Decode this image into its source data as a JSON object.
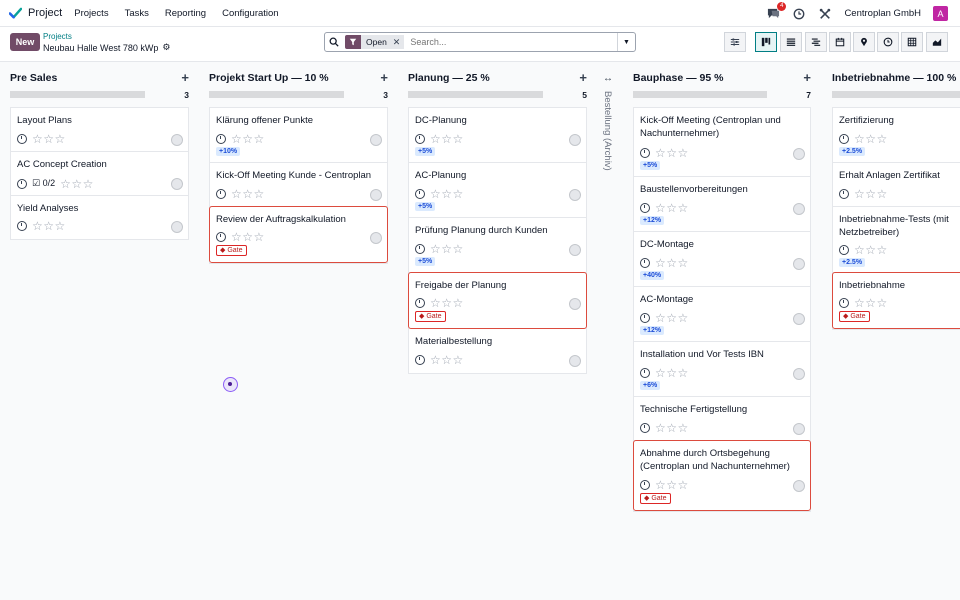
{
  "navbar": {
    "app_name": "Project",
    "menu": [
      "Projects",
      "Tasks",
      "Reporting",
      "Configuration"
    ],
    "chat_badge": "4",
    "company": "Centroplan GmbH",
    "avatar_letter": "A"
  },
  "control": {
    "new_label": "New",
    "breadcrumb_parent": "Projects",
    "breadcrumb_current": "Neubau Halle West 780 kWp",
    "facet_value": "Open",
    "search_placeholder": "Search..."
  },
  "columns": [
    {
      "title": "Pre Sales",
      "count": "3",
      "cards": [
        {
          "title": "Layout Plans"
        },
        {
          "title": "AC Concept Creation",
          "checklist": "0/2"
        },
        {
          "title": "Yield Analyses"
        }
      ]
    },
    {
      "title": "Projekt Start Up — 10 %",
      "count": "3",
      "cards": [
        {
          "title": "Klärung offener Punkte",
          "tag": "+10%"
        },
        {
          "title": "Kick-Off Meeting Kunde - Centroplan"
        },
        {
          "title": "Review der Auftragskalkulation",
          "gate": "Gate"
        }
      ]
    },
    {
      "title": "Planung — 25 %",
      "count": "5",
      "cards": [
        {
          "title": "DC-Planung",
          "tag": "+5%"
        },
        {
          "title": "AC-Planung",
          "tag": "+5%"
        },
        {
          "title": "Prüfung Planung durch Kunden",
          "tag": "+5%"
        },
        {
          "title": "Freigabe der Planung",
          "gate": "Gate"
        },
        {
          "title": "Materialbestellung"
        }
      ]
    },
    {
      "title": "Bauphase — 95 %",
      "count": "7",
      "cards": [
        {
          "title": "Kick-Off Meeting (Centroplan und Nachunternehmer)",
          "tag": "+5%"
        },
        {
          "title": "Baustellenvorbereitungen",
          "tag": "+12%"
        },
        {
          "title": "DC-Montage",
          "tag": "+40%"
        },
        {
          "title": "AC-Montage",
          "tag": "+12%"
        },
        {
          "title": "Installation und Vor Tests IBN",
          "tag": "+6%"
        },
        {
          "title": "Technische Fertigstellung"
        },
        {
          "title": "Abnahme durch Ortsbegehung (Centroplan und Nachunternehmer)",
          "gate": "Gate"
        }
      ]
    },
    {
      "title": "Inbetriebnahme — 100 %",
      "count": "",
      "cards": [
        {
          "title": "Zertifizierung",
          "tag": "+2.5%"
        },
        {
          "title": "Erhalt Anlagen Zertifikat"
        },
        {
          "title": "Inbetriebnahme-Tests (mit Netzbetreiber)",
          "tag": "+2.5%"
        },
        {
          "title": "Inbetriebnahme",
          "gate": "Gate"
        }
      ]
    }
  ],
  "folded_column": {
    "title": "Bestellung (Archiv)"
  }
}
